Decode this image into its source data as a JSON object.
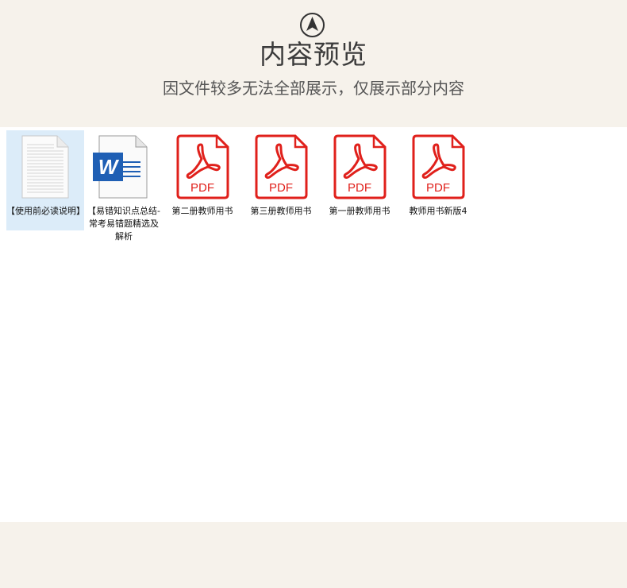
{
  "header": {
    "nav_icon": "navigation-arrow-icon",
    "title": "内容预览",
    "subtitle": "因文件较多无法全部展示，仅展示部分内容"
  },
  "files": [
    {
      "name": "【使用前必读说明】",
      "type": "text",
      "icon": "text-document-icon",
      "selected": true
    },
    {
      "name": "【易错知识点总结-常考易错题精选及解析",
      "type": "word",
      "icon": "word-document-icon",
      "selected": false
    },
    {
      "name": "第二册教师用书",
      "type": "pdf",
      "icon": "pdf-icon",
      "badge": "PDF",
      "selected": false
    },
    {
      "name": "第三册教师用书",
      "type": "pdf",
      "icon": "pdf-icon",
      "badge": "PDF",
      "selected": false
    },
    {
      "name": "第一册教师用书",
      "type": "pdf",
      "icon": "pdf-icon",
      "badge": "PDF",
      "selected": false
    },
    {
      "name": "教师用书新版4",
      "type": "pdf",
      "icon": "pdf-icon",
      "badge": "PDF",
      "selected": false
    }
  ],
  "colors": {
    "background": "#f6f2eb",
    "content": "#ffffff",
    "pdf_red": "#e0201b",
    "word_blue": "#1f5fb4",
    "selection": "#dcecf9"
  }
}
